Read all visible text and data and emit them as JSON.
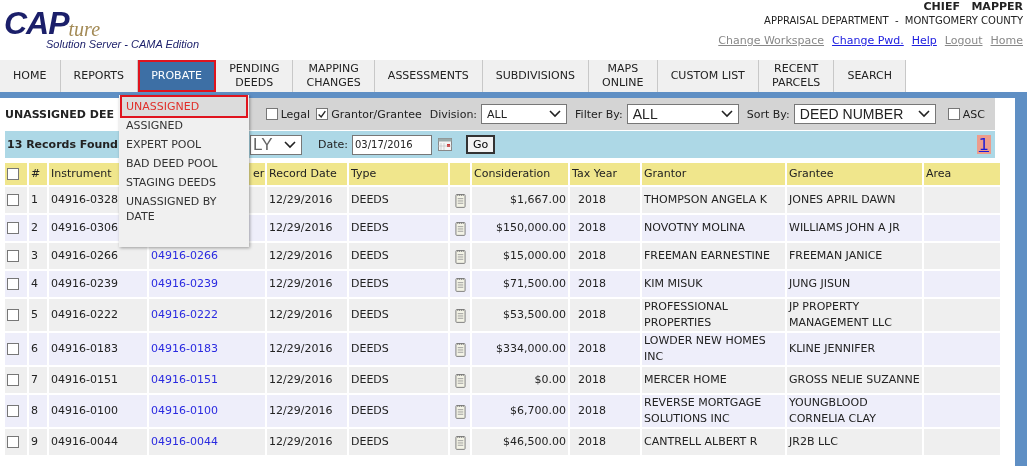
{
  "header": {
    "logo": {
      "main": "CAP",
      "script": "ture",
      "tagline": "Solution Server - CAMA Edition"
    },
    "user": "CHIEF   MAPPER",
    "department": "APPRAISAL DEPARTMENT  -  MONTGOMERY COUNTY",
    "links": [
      {
        "label": "Change Workspace",
        "enabled": false
      },
      {
        "label": "Change Pwd.",
        "enabled": true
      },
      {
        "label": "Help",
        "enabled": true
      },
      {
        "label": "Logout",
        "enabled": false
      },
      {
        "label": "Home",
        "enabled": false
      }
    ]
  },
  "nav": [
    {
      "label": "HOME",
      "selected": false
    },
    {
      "label": "REPORTS",
      "selected": false
    },
    {
      "label": "PROBATE",
      "selected": true
    },
    {
      "label": "PENDING\nDEEDS",
      "selected": false
    },
    {
      "label": "MAPPING\nCHANGES",
      "selected": false
    },
    {
      "label": "ASSESSMENTS",
      "selected": false
    },
    {
      "label": "SUBDIVISIONS",
      "selected": false
    },
    {
      "label": "MAPS\nONLINE",
      "selected": false
    },
    {
      "label": "CUSTOM LIST",
      "selected": false
    },
    {
      "label": "RECENT\nPARCELS",
      "selected": false
    },
    {
      "label": "SEARCH",
      "selected": false
    }
  ],
  "probate_menu": [
    {
      "label": "UNASSIGNED",
      "selected": true
    },
    {
      "label": "ASSIGNED",
      "selected": false
    },
    {
      "label": "EXPERT POOL",
      "selected": false
    },
    {
      "label": "BAD DEED POOL",
      "selected": false
    },
    {
      "label": "STAGING DEEDS",
      "selected": false
    },
    {
      "label": "UNASSIGNED BY DATE",
      "selected": false
    }
  ],
  "filters": {
    "title": "UNASSIGNED DEE",
    "options": [
      {
        "label": "Legal",
        "checked": false
      },
      {
        "label": "Grantor/Grantee",
        "checked": true
      }
    ],
    "division": {
      "label": "Division:",
      "value": "ALL"
    },
    "filter_by": {
      "label": "Filter By:",
      "value": "ALL"
    },
    "sort_by": {
      "label": "Sort By:",
      "value": "DEED NUMBER"
    },
    "asc": {
      "label": "ASC",
      "checked": false
    }
  },
  "records": {
    "count": "13 Records Found",
    "type_value": "LY",
    "date_label": "Date:",
    "date": "03/17/2016",
    "go": "Go",
    "pages": [
      {
        "label": "1",
        "selected": true
      }
    ]
  },
  "table": {
    "select_all": {
      "checked": false
    },
    "columns": [
      "#",
      "Instrument",
      "er",
      "Record Date",
      "Type",
      "Consideration",
      "Tax Year",
      "Grantor",
      "Grantee",
      "Area"
    ],
    "rows": [
      {
        "checked": false,
        "n": "1",
        "instrument": "04916-0328",
        "record_date": "12/29/2016",
        "type": "DEEDS",
        "consideration": "$1,667.00",
        "tax_year": "2018",
        "grantor": "THOMPSON ANGELA K",
        "grantee": "JONES APRIL DAWN"
      },
      {
        "checked": false,
        "n": "2",
        "instrument": "04916-0306",
        "record_date": "12/29/2016",
        "type": "DEEDS",
        "consideration": "$150,000.00",
        "tax_year": "2018",
        "grantor": "NOVOTNY MOLINA",
        "grantee": "WILLIAMS JOHN A JR"
      },
      {
        "checked": false,
        "n": "3",
        "instrument": "04916-0266",
        "link": "04916-0266",
        "record_date": "12/29/2016",
        "type": "DEEDS",
        "consideration": "$15,000.00",
        "tax_year": "2018",
        "grantor": "FREEMAN EARNESTINE",
        "grantee": "FREEMAN JANICE"
      },
      {
        "checked": false,
        "n": "4",
        "instrument": "04916-0239",
        "link": "04916-0239",
        "record_date": "12/29/2016",
        "type": "DEEDS",
        "consideration": "$71,500.00",
        "tax_year": "2018",
        "grantor": "KIM MISUK",
        "grantee": "JUNG JISUN"
      },
      {
        "checked": false,
        "n": "5",
        "instrument": "04916-0222",
        "link": "04916-0222",
        "record_date": "12/29/2016",
        "type": "DEEDS",
        "consideration": "$53,500.00",
        "tax_year": "2018",
        "grantor": "PROFESSIONAL PROPERTIES",
        "grantee": "JP PROPERTY MANAGEMENT LLC"
      },
      {
        "checked": false,
        "n": "6",
        "instrument": "04916-0183",
        "link": "04916-0183",
        "record_date": "12/29/2016",
        "type": "DEEDS",
        "consideration": "$334,000.00",
        "tax_year": "2018",
        "grantor": "LOWDER NEW HOMES INC",
        "grantee": "KLINE JENNIFER"
      },
      {
        "checked": false,
        "n": "7",
        "instrument": "04916-0151",
        "link": "04916-0151",
        "record_date": "12/29/2016",
        "type": "DEEDS",
        "consideration": "$0.00",
        "tax_year": "2018",
        "grantor": "MERCER HOME",
        "grantee": "GROSS NELIE SUZANNE"
      },
      {
        "checked": false,
        "n": "8",
        "instrument": "04916-0100",
        "link": "04916-0100",
        "record_date": "12/29/2016",
        "type": "DEEDS",
        "consideration": "$6,700.00",
        "tax_year": "2018",
        "grantor": "REVERSE MORTGAGE SOLUTIONS INC",
        "grantee": "YOUNGBLOOD CORNELIA CLAY"
      },
      {
        "checked": false,
        "n": "9",
        "instrument": "04916-0044",
        "link": "04916-0044",
        "record_date": "12/29/2016",
        "type": "DEEDS",
        "consideration": "$46,500.00",
        "tax_year": "2018",
        "grantor": "CANTRELL ALBERT R",
        "grantee": "JR2B LLC"
      }
    ]
  }
}
